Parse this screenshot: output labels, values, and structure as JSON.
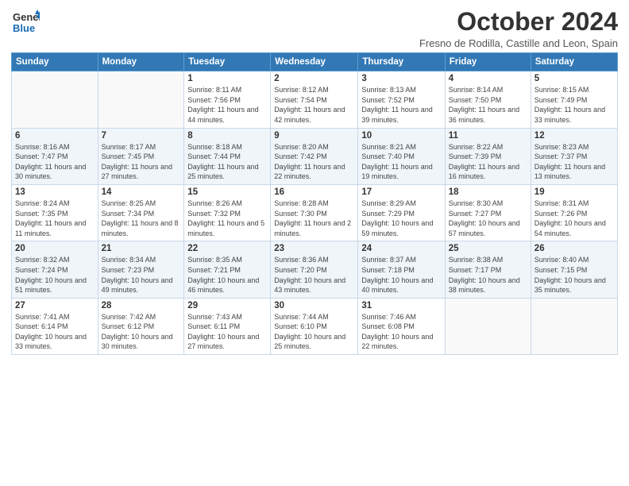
{
  "header": {
    "logo": {
      "line1": "General",
      "line2": "Blue"
    },
    "title": "October 2024",
    "location": "Fresno de Rodilla, Castille and Leon, Spain"
  },
  "weekdays": [
    "Sunday",
    "Monday",
    "Tuesday",
    "Wednesday",
    "Thursday",
    "Friday",
    "Saturday"
  ],
  "weeks": [
    [
      {
        "day": "",
        "info": ""
      },
      {
        "day": "",
        "info": ""
      },
      {
        "day": "1",
        "info": "Sunrise: 8:11 AM\nSunset: 7:56 PM\nDaylight: 11 hours and 44 minutes."
      },
      {
        "day": "2",
        "info": "Sunrise: 8:12 AM\nSunset: 7:54 PM\nDaylight: 11 hours and 42 minutes."
      },
      {
        "day": "3",
        "info": "Sunrise: 8:13 AM\nSunset: 7:52 PM\nDaylight: 11 hours and 39 minutes."
      },
      {
        "day": "4",
        "info": "Sunrise: 8:14 AM\nSunset: 7:50 PM\nDaylight: 11 hours and 36 minutes."
      },
      {
        "day": "5",
        "info": "Sunrise: 8:15 AM\nSunset: 7:49 PM\nDaylight: 11 hours and 33 minutes."
      }
    ],
    [
      {
        "day": "6",
        "info": "Sunrise: 8:16 AM\nSunset: 7:47 PM\nDaylight: 11 hours and 30 minutes."
      },
      {
        "day": "7",
        "info": "Sunrise: 8:17 AM\nSunset: 7:45 PM\nDaylight: 11 hours and 27 minutes."
      },
      {
        "day": "8",
        "info": "Sunrise: 8:18 AM\nSunset: 7:44 PM\nDaylight: 11 hours and 25 minutes."
      },
      {
        "day": "9",
        "info": "Sunrise: 8:20 AM\nSunset: 7:42 PM\nDaylight: 11 hours and 22 minutes."
      },
      {
        "day": "10",
        "info": "Sunrise: 8:21 AM\nSunset: 7:40 PM\nDaylight: 11 hours and 19 minutes."
      },
      {
        "day": "11",
        "info": "Sunrise: 8:22 AM\nSunset: 7:39 PM\nDaylight: 11 hours and 16 minutes."
      },
      {
        "day": "12",
        "info": "Sunrise: 8:23 AM\nSunset: 7:37 PM\nDaylight: 11 hours and 13 minutes."
      }
    ],
    [
      {
        "day": "13",
        "info": "Sunrise: 8:24 AM\nSunset: 7:35 PM\nDaylight: 11 hours and 11 minutes."
      },
      {
        "day": "14",
        "info": "Sunrise: 8:25 AM\nSunset: 7:34 PM\nDaylight: 11 hours and 8 minutes."
      },
      {
        "day": "15",
        "info": "Sunrise: 8:26 AM\nSunset: 7:32 PM\nDaylight: 11 hours and 5 minutes."
      },
      {
        "day": "16",
        "info": "Sunrise: 8:28 AM\nSunset: 7:30 PM\nDaylight: 11 hours and 2 minutes."
      },
      {
        "day": "17",
        "info": "Sunrise: 8:29 AM\nSunset: 7:29 PM\nDaylight: 10 hours and 59 minutes."
      },
      {
        "day": "18",
        "info": "Sunrise: 8:30 AM\nSunset: 7:27 PM\nDaylight: 10 hours and 57 minutes."
      },
      {
        "day": "19",
        "info": "Sunrise: 8:31 AM\nSunset: 7:26 PM\nDaylight: 10 hours and 54 minutes."
      }
    ],
    [
      {
        "day": "20",
        "info": "Sunrise: 8:32 AM\nSunset: 7:24 PM\nDaylight: 10 hours and 51 minutes."
      },
      {
        "day": "21",
        "info": "Sunrise: 8:34 AM\nSunset: 7:23 PM\nDaylight: 10 hours and 49 minutes."
      },
      {
        "day": "22",
        "info": "Sunrise: 8:35 AM\nSunset: 7:21 PM\nDaylight: 10 hours and 46 minutes."
      },
      {
        "day": "23",
        "info": "Sunrise: 8:36 AM\nSunset: 7:20 PM\nDaylight: 10 hours and 43 minutes."
      },
      {
        "day": "24",
        "info": "Sunrise: 8:37 AM\nSunset: 7:18 PM\nDaylight: 10 hours and 40 minutes."
      },
      {
        "day": "25",
        "info": "Sunrise: 8:38 AM\nSunset: 7:17 PM\nDaylight: 10 hours and 38 minutes."
      },
      {
        "day": "26",
        "info": "Sunrise: 8:40 AM\nSunset: 7:15 PM\nDaylight: 10 hours and 35 minutes."
      }
    ],
    [
      {
        "day": "27",
        "info": "Sunrise: 7:41 AM\nSunset: 6:14 PM\nDaylight: 10 hours and 33 minutes."
      },
      {
        "day": "28",
        "info": "Sunrise: 7:42 AM\nSunset: 6:12 PM\nDaylight: 10 hours and 30 minutes."
      },
      {
        "day": "29",
        "info": "Sunrise: 7:43 AM\nSunset: 6:11 PM\nDaylight: 10 hours and 27 minutes."
      },
      {
        "day": "30",
        "info": "Sunrise: 7:44 AM\nSunset: 6:10 PM\nDaylight: 10 hours and 25 minutes."
      },
      {
        "day": "31",
        "info": "Sunrise: 7:46 AM\nSunset: 6:08 PM\nDaylight: 10 hours and 22 minutes."
      },
      {
        "day": "",
        "info": ""
      },
      {
        "day": "",
        "info": ""
      }
    ]
  ]
}
